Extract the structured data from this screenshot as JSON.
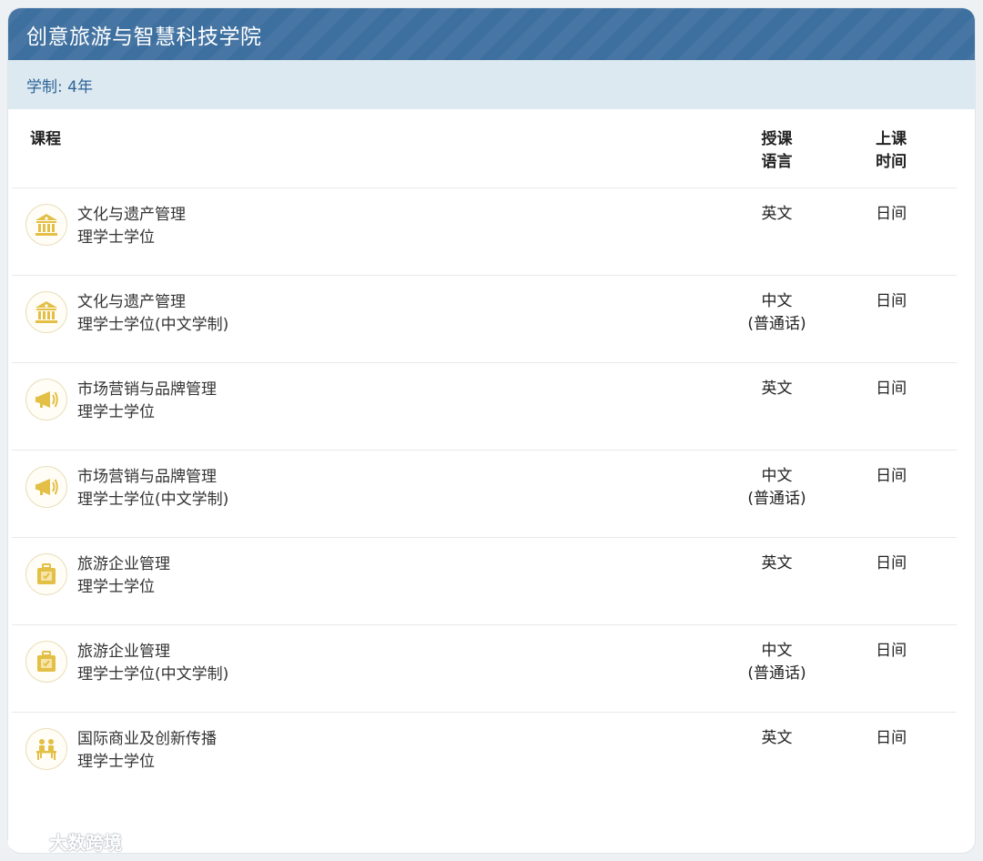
{
  "header": {
    "title": "创意旅游与智慧科技学院"
  },
  "subbar": {
    "duration": "学制: 4年"
  },
  "table": {
    "headers": {
      "course": "课程",
      "lang_line1": "授课",
      "lang_line2": "语言",
      "time_line1": "上课",
      "time_line2": "时间"
    },
    "rows": [
      {
        "icon": "museum-icon",
        "name": "文化与遗产管理",
        "degree": "理学士学位",
        "lang1": "英文",
        "lang2": "",
        "time": "日间"
      },
      {
        "icon": "museum-icon",
        "name": "文化与遗产管理",
        "degree": "理学士学位(中文学制)",
        "lang1": "中文",
        "lang2": "(普通话)",
        "time": "日间"
      },
      {
        "icon": "megaphone-icon",
        "name": "市场营销与品牌管理",
        "degree": "理学士学位",
        "lang1": "英文",
        "lang2": "",
        "time": "日间"
      },
      {
        "icon": "megaphone-icon",
        "name": "市场营销与品牌管理",
        "degree": "理学士学位(中文学制)",
        "lang1": "中文",
        "lang2": "(普通话)",
        "time": "日间"
      },
      {
        "icon": "suitcase-icon",
        "name": "旅游企业管理",
        "degree": "理学士学位",
        "lang1": "英文",
        "lang2": "",
        "time": "日间"
      },
      {
        "icon": "suitcase-icon",
        "name": "旅游企业管理",
        "degree": "理学士学位(中文学制)",
        "lang1": "中文",
        "lang2": "(普通话)",
        "time": "日间"
      },
      {
        "icon": "business-people-icon",
        "name": "国际商业及创新传播",
        "degree": "理学士学位",
        "lang1": "英文",
        "lang2": "",
        "time": "日间"
      }
    ]
  },
  "watermark": {
    "text": "大数跨境"
  },
  "colors": {
    "header_bg": "#3d6f9f",
    "subbar_bg": "#dce9f1",
    "subbar_text": "#2f6596",
    "icon_gold": "#e3bf45"
  }
}
